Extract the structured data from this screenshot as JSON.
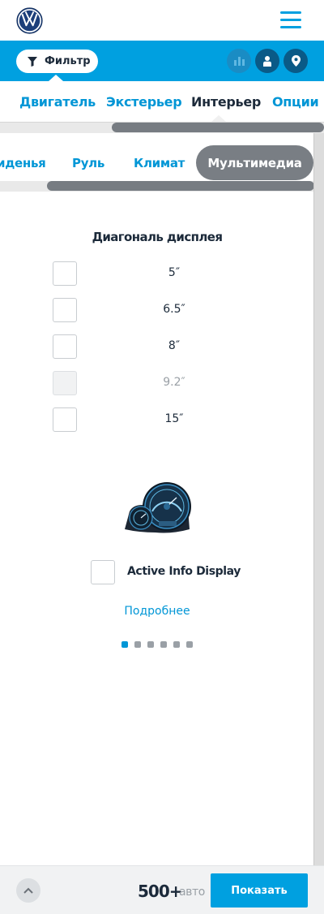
{
  "header": {
    "logo_icon": "vw-logo-icon",
    "menu_icon": "hamburger-menu-icon"
  },
  "filterbar": {
    "filter_label": "Фильтр",
    "filter_icon": "funnel-icon",
    "actions": [
      "chart-icon",
      "person-icon",
      "location-pin-icon"
    ]
  },
  "tabs": {
    "items": [
      "Двигатель",
      "Экстерьер",
      "Интерьер",
      "Опции"
    ],
    "active": "Интерьер"
  },
  "subtabs": {
    "items": [
      "иденья",
      "Руль",
      "Климат",
      "Мультимедиа"
    ],
    "active": "Мультимедиа"
  },
  "display": {
    "title": "Диагональ дисплея",
    "options": [
      {
        "label": "5″",
        "enabled": true
      },
      {
        "label": "6.5″",
        "enabled": true
      },
      {
        "label": "8″",
        "enabled": true
      },
      {
        "label": "9.2″",
        "enabled": false
      },
      {
        "label": "15″",
        "enabled": true
      }
    ]
  },
  "feature": {
    "label": "Active Info Display",
    "more": "Подробнее",
    "image_icon": "instrument-cluster-icon",
    "slides": 6,
    "active_slide": 1
  },
  "footer": {
    "count": "500+",
    "unit": "авто",
    "show_label": "Показать",
    "up_icon": "chevron-up-icon"
  },
  "colors": {
    "accent": "#00a0e0",
    "dark": "#1c2a3a",
    "pill": "#797e84"
  }
}
